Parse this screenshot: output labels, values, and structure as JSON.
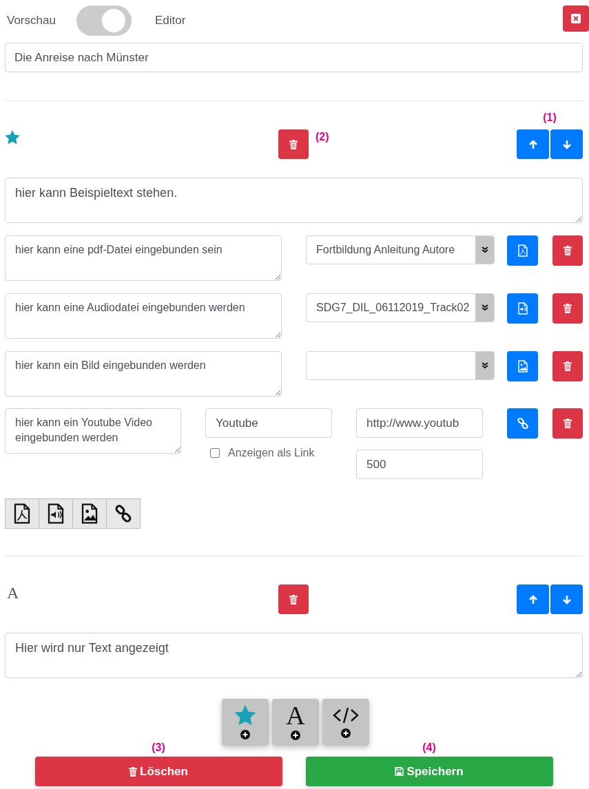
{
  "header": {
    "left_label": "Vorschau",
    "toggle": {
      "on": false
    },
    "right_label": "Editor"
  },
  "title_field": {
    "value": "Die Anreise nach Münster"
  },
  "blocks": [
    {
      "kind": "star",
      "move_note": "(1)",
      "delete_note": "(2)",
      "text": "hier kann Beispieltext stehen.",
      "media": [
        {
          "kind": "pdf",
          "caption": "hier kann eine pdf-Datei eingebunden sein",
          "file": "Fortbildung Anleitung Autore"
        },
        {
          "kind": "audio",
          "caption": "hier kann eine Audiodatei eingebunden werden",
          "file": "SDG7_DIL_06112019_Track02"
        },
        {
          "kind": "image",
          "caption": "hier kann ein Bild eingebunden werden"
        }
      ],
      "video": {
        "caption": "hier kann ein Youtube Video eingebunden werden",
        "title": "Youtube",
        "url": "http://www.youtub",
        "as_link_label": "Anzeigen als Link",
        "as_link": false,
        "size": "500"
      },
      "toolbar": [
        {
          "kind": "pdf"
        },
        {
          "kind": "audio"
        },
        {
          "kind": "image"
        },
        {
          "kind": "link"
        }
      ]
    },
    {
      "kind": "text",
      "glyph": "A",
      "text": "Hier wird nur Text angezeigt"
    }
  ],
  "add_buttons": [
    {
      "kind": "star"
    },
    {
      "kind": "text",
      "glyph": "A"
    },
    {
      "kind": "code"
    }
  ],
  "actions": [
    {
      "kind": "delete",
      "label": "Löschen",
      "note": "(3)"
    },
    {
      "kind": "save",
      "label": "Speichern",
      "note": "(4)"
    }
  ]
}
